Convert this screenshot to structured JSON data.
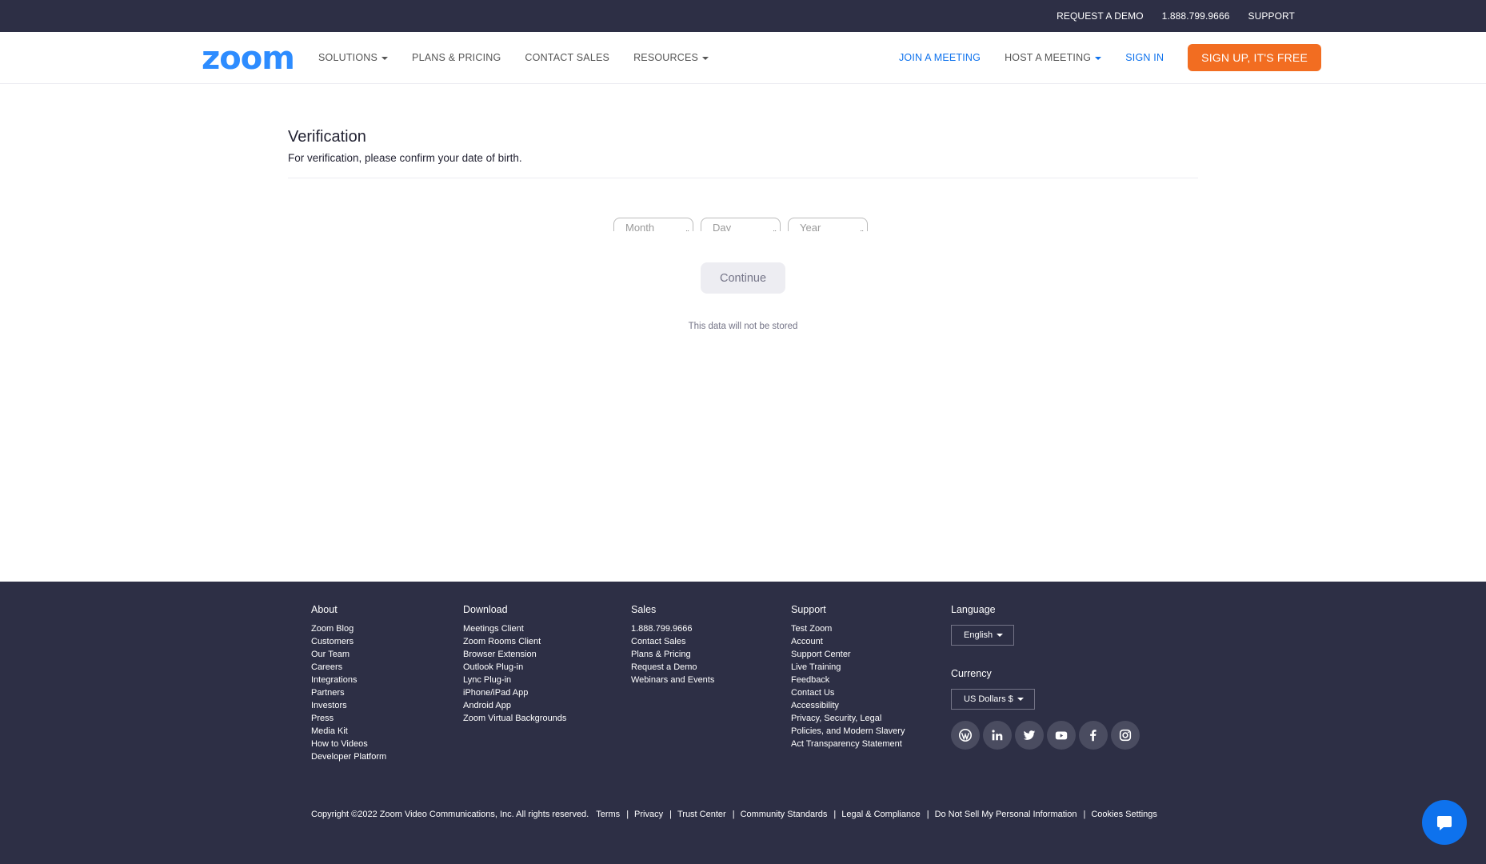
{
  "topbar": {
    "request_demo": "REQUEST A DEMO",
    "phone": "1.888.799.9666",
    "support": "SUPPORT"
  },
  "navbar": {
    "logo": "zoom",
    "solutions": "SOLUTIONS",
    "plans_pricing": "PLANS & PRICING",
    "contact_sales": "CONTACT SALES",
    "resources": "RESOURCES",
    "join_meeting": "JOIN A MEETING",
    "host_meeting": "HOST A MEETING",
    "sign_in": "SIGN IN",
    "sign_up": "SIGN UP, IT'S FREE"
  },
  "main": {
    "title": "Verification",
    "subtitle": "For verification, please confirm your date of birth.",
    "month_placeholder": "Month",
    "day_placeholder": "Day",
    "year_placeholder": "Year",
    "continue_label": "Continue",
    "note": "This data will not be stored"
  },
  "footer": {
    "about": {
      "heading": "About",
      "items": [
        "Zoom Blog",
        "Customers",
        "Our Team",
        "Careers",
        "Integrations",
        "Partners",
        "Investors",
        "Press",
        "Media Kit",
        "How to Videos",
        "Developer Platform"
      ]
    },
    "download": {
      "heading": "Download",
      "items": [
        "Meetings Client",
        "Zoom Rooms Client",
        "Browser Extension",
        "Outlook Plug-in",
        "Lync Plug-in",
        "iPhone/iPad App",
        "Android App",
        "Zoom Virtual Backgrounds"
      ]
    },
    "sales": {
      "heading": "Sales",
      "items": [
        "1.888.799.9666",
        "Contact Sales",
        "Plans & Pricing",
        "Request a Demo",
        "Webinars and Events"
      ]
    },
    "support": {
      "heading": "Support",
      "items": [
        "Test Zoom",
        "Account",
        "Support Center",
        "Live Training",
        "Feedback",
        "Contact Us",
        "Accessibility",
        "Privacy, Security, Legal",
        "Policies, and Modern Slavery",
        "Act Transparency Statement"
      ]
    },
    "language": {
      "heading": "Language",
      "value": "English"
    },
    "currency": {
      "heading": "Currency",
      "value": "US Dollars $"
    },
    "social_icons": [
      "wordpress-icon",
      "linkedin-icon",
      "twitter-icon",
      "youtube-icon",
      "facebook-icon",
      "instagram-icon"
    ],
    "legal": {
      "copyright": "Copyright ©2022 Zoom Video Communications, Inc. All rights reserved.",
      "terms": "Terms",
      "privacy": "Privacy",
      "trust_center": "Trust Center",
      "community_standards": "Community Standards",
      "legal_compliance": "Legal & Compliance",
      "do_not_sell": "Do Not Sell My Personal Information",
      "cookies_settings": "Cookies Settings"
    }
  },
  "colors": {
    "dark_bg": "#2d2f45",
    "brand_blue": "#0e72ed",
    "logo_blue": "#2d8cff",
    "signup_orange": "#f26d21"
  }
}
